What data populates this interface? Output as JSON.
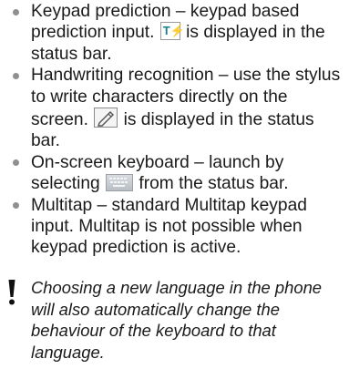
{
  "bullets": [
    {
      "before_icon": "Keypad prediction – keypad based prediction input. ",
      "icon": "t9-prediction-icon",
      "after_icon": " is displayed in the status bar."
    },
    {
      "before_icon": "Handwriting recognition – use the stylus to write characters directly on the screen. ",
      "icon": "handwriting-icon",
      "after_icon": " is displayed in the status bar."
    },
    {
      "before_icon": "On-screen keyboard – launch by selecting ",
      "icon": "keyboard-icon",
      "after_icon": " from the status bar."
    },
    {
      "text": "Multitap – standard Multitap keypad input. Multitap is not possible when keypad prediction is active."
    }
  ],
  "note": {
    "icon": "exclamation-icon",
    "text": "Choosing a new language in the phone will also automatically change the behaviour of the keyboard to that language."
  },
  "colors": {
    "text": "#1a1a1a",
    "bullet": "#8f8f8f",
    "t9_letter": "#1a7f8c",
    "t9_bolt": "#d0302a"
  }
}
